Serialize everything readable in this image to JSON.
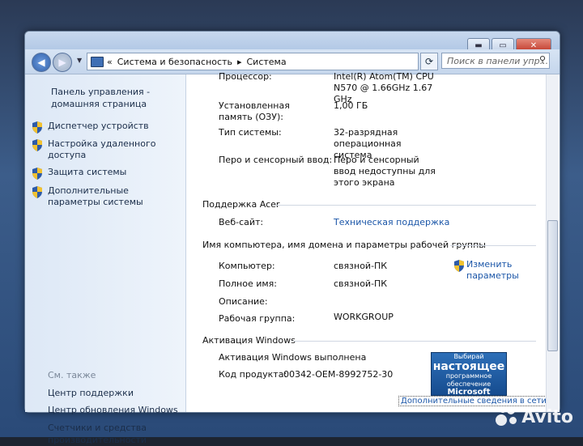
{
  "titlebar": {
    "minimize_icon": "minimize-icon",
    "maximize_icon": "maximize-icon",
    "close_icon": "close-icon"
  },
  "navbar": {
    "breadcrumb_root_symbol": "«",
    "breadcrumb": [
      "Система и безопасность",
      "Система"
    ],
    "separator": "▸",
    "search_placeholder": "Поиск в панели упр..."
  },
  "sidebar": {
    "home": "Панель управления - домашняя страница",
    "items": [
      {
        "label": "Диспетчер устройств"
      },
      {
        "label": "Настройка удаленного доступа"
      },
      {
        "label": "Защита системы"
      },
      {
        "label": "Дополнительные параметры системы"
      }
    ],
    "see_also": "См. также",
    "see_also_links": [
      {
        "label": "Центр поддержки"
      },
      {
        "label": "Центр обновления Windows"
      },
      {
        "label": "Счетчики и средства производительности"
      }
    ]
  },
  "system": {
    "processor_label": "Процессор:",
    "processor_value": "Intel(R) Atom(TM) CPU N570   @ 1.66GHz   1.67 GHz",
    "memory_label": "Установленная память (ОЗУ):",
    "memory_value": "1,00 ГБ",
    "type_label": "Тип системы:",
    "type_value": "32-разрядная операционная система",
    "pen_label": "Перо и сенсорный ввод:",
    "pen_value": "Перо и сенсорный ввод недоступны для этого экрана"
  },
  "support": {
    "section": "Поддержка Acer",
    "website_label": "Веб-сайт:",
    "website_value": "Техническая поддержка"
  },
  "computer": {
    "section": "Имя компьютера, имя домена и параметры рабочей группы",
    "name_label": "Компьютер:",
    "name_value": "связной-ПК",
    "full_label": "Полное имя:",
    "full_value": "связной-ПК",
    "desc_label": "Описание:",
    "desc_value": "",
    "workgroup_label": "Рабочая группа:",
    "workgroup_value": "WORKGROUP",
    "change_link": "Изменить параметры"
  },
  "activation": {
    "section": "Активация Windows",
    "status": "Активация Windows выполнена",
    "product_label": "Код продукта:",
    "product_value": "00342-OEM-8992752-30",
    "badge_line1": "Выбирай",
    "badge_line2": "настоящее",
    "badge_line3": "программное обеспечение",
    "badge_line4": "Microsoft",
    "more_info": "Дополнительные сведения в сети..."
  },
  "watermark": {
    "text": "Avito"
  }
}
